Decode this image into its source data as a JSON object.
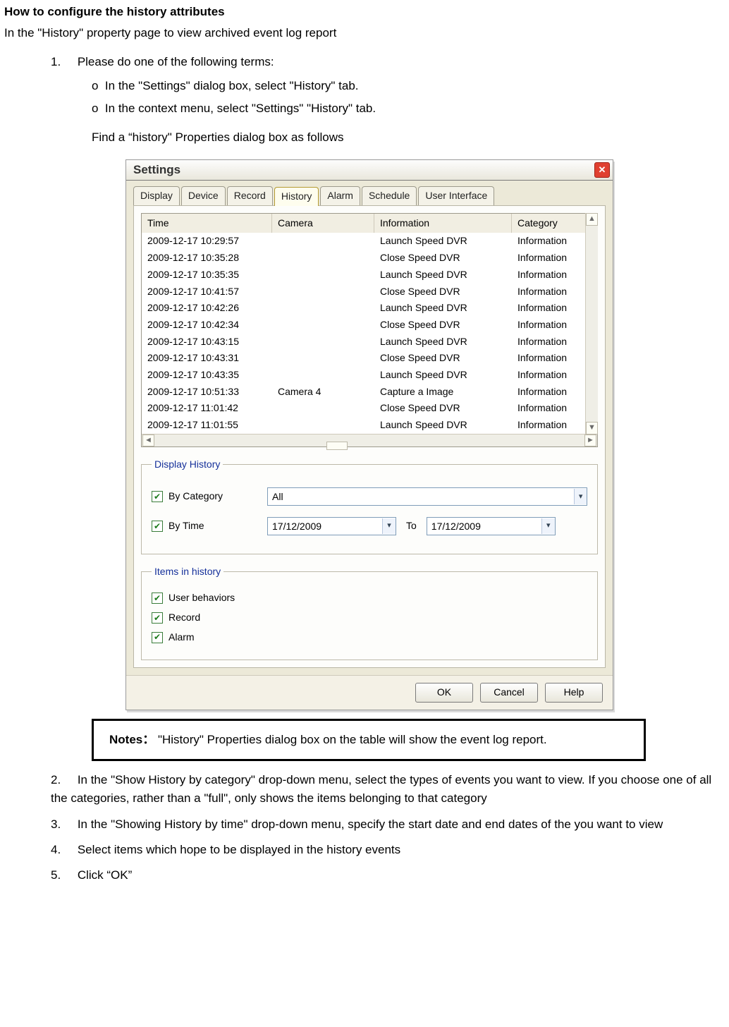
{
  "heading": "How to configure the history attributes",
  "intro": "In the \"History\" property page to view archived event log report",
  "steps": {
    "s1_n": "1.",
    "s1": "Please do one of the following terms:",
    "s1a_b": "o",
    "s1a": "In the \"Settings\" dialog box, select \"History\" tab.",
    "s1b_b": "o",
    "s1b": "In the context menu, select \"Settings\" \"History\" tab.",
    "find": "Find a “history\" Properties dialog box as follows",
    "s2_n": "2.",
    "s2": "In the \"Show History by category\" drop-down menu, select the types of events you want to view. If you choose one of all the categories, rather than a \"full\", only shows the items belonging to that category",
    "s3_n": "3.",
    "s3": "In the \"Showing History by time\" drop-down menu, specify the start date and end dates of the you want to view",
    "s4_n": "4.",
    "s4": "Select items which hope to be displayed in the history events",
    "s5_n": "5.",
    "s5": "Click “OK”"
  },
  "notes": {
    "label": "Notes：",
    "text": "\"History\" Properties dialog box on the table will show the event log report."
  },
  "dialog": {
    "title": "Settings",
    "tabs": [
      "Display",
      "Device",
      "Record",
      "History",
      "Alarm",
      "Schedule",
      "User Interface"
    ],
    "active_tab_index": 3,
    "columns": [
      "Time",
      "Camera",
      "Information",
      "Category"
    ],
    "rows": [
      {
        "t": "2009-12-17 10:29:57",
        "c": "",
        "i": "Launch Speed DVR",
        "g": "Information"
      },
      {
        "t": "2009-12-17 10:35:28",
        "c": "",
        "i": "Close Speed DVR",
        "g": "Information"
      },
      {
        "t": "2009-12-17 10:35:35",
        "c": "",
        "i": "Launch Speed DVR",
        "g": "Information"
      },
      {
        "t": "2009-12-17 10:41:57",
        "c": "",
        "i": "Close Speed DVR",
        "g": "Information"
      },
      {
        "t": "2009-12-17 10:42:26",
        "c": "",
        "i": "Launch Speed DVR",
        "g": "Information"
      },
      {
        "t": "2009-12-17 10:42:34",
        "c": "",
        "i": "Close Speed DVR",
        "g": "Information"
      },
      {
        "t": "2009-12-17 10:43:15",
        "c": "",
        "i": "Launch Speed DVR",
        "g": "Information"
      },
      {
        "t": "2009-12-17 10:43:31",
        "c": "",
        "i": "Close Speed DVR",
        "g": "Information"
      },
      {
        "t": "2009-12-17 10:43:35",
        "c": "",
        "i": "Launch Speed DVR",
        "g": "Information"
      },
      {
        "t": "2009-12-17 10:51:33",
        "c": "Camera 4",
        "i": "Capture a Image",
        "g": "Information"
      },
      {
        "t": "2009-12-17 11:01:42",
        "c": "",
        "i": "Close Speed DVR",
        "g": "Information"
      },
      {
        "t": "2009-12-17 11:01:55",
        "c": "",
        "i": "Launch Speed DVR",
        "g": "Information"
      }
    ],
    "group1": {
      "legend": "Display History",
      "by_cat": "By Category",
      "cat_sel": "All",
      "by_time": "By Time",
      "from": "17/12/2009",
      "to_label": "To",
      "to": "17/12/2009"
    },
    "group2": {
      "legend": "Items in history",
      "c1": "User behaviors",
      "c2": "Record",
      "c3": "Alarm"
    },
    "buttons": {
      "ok": "OK",
      "cancel": "Cancel",
      "help": "Help"
    }
  }
}
